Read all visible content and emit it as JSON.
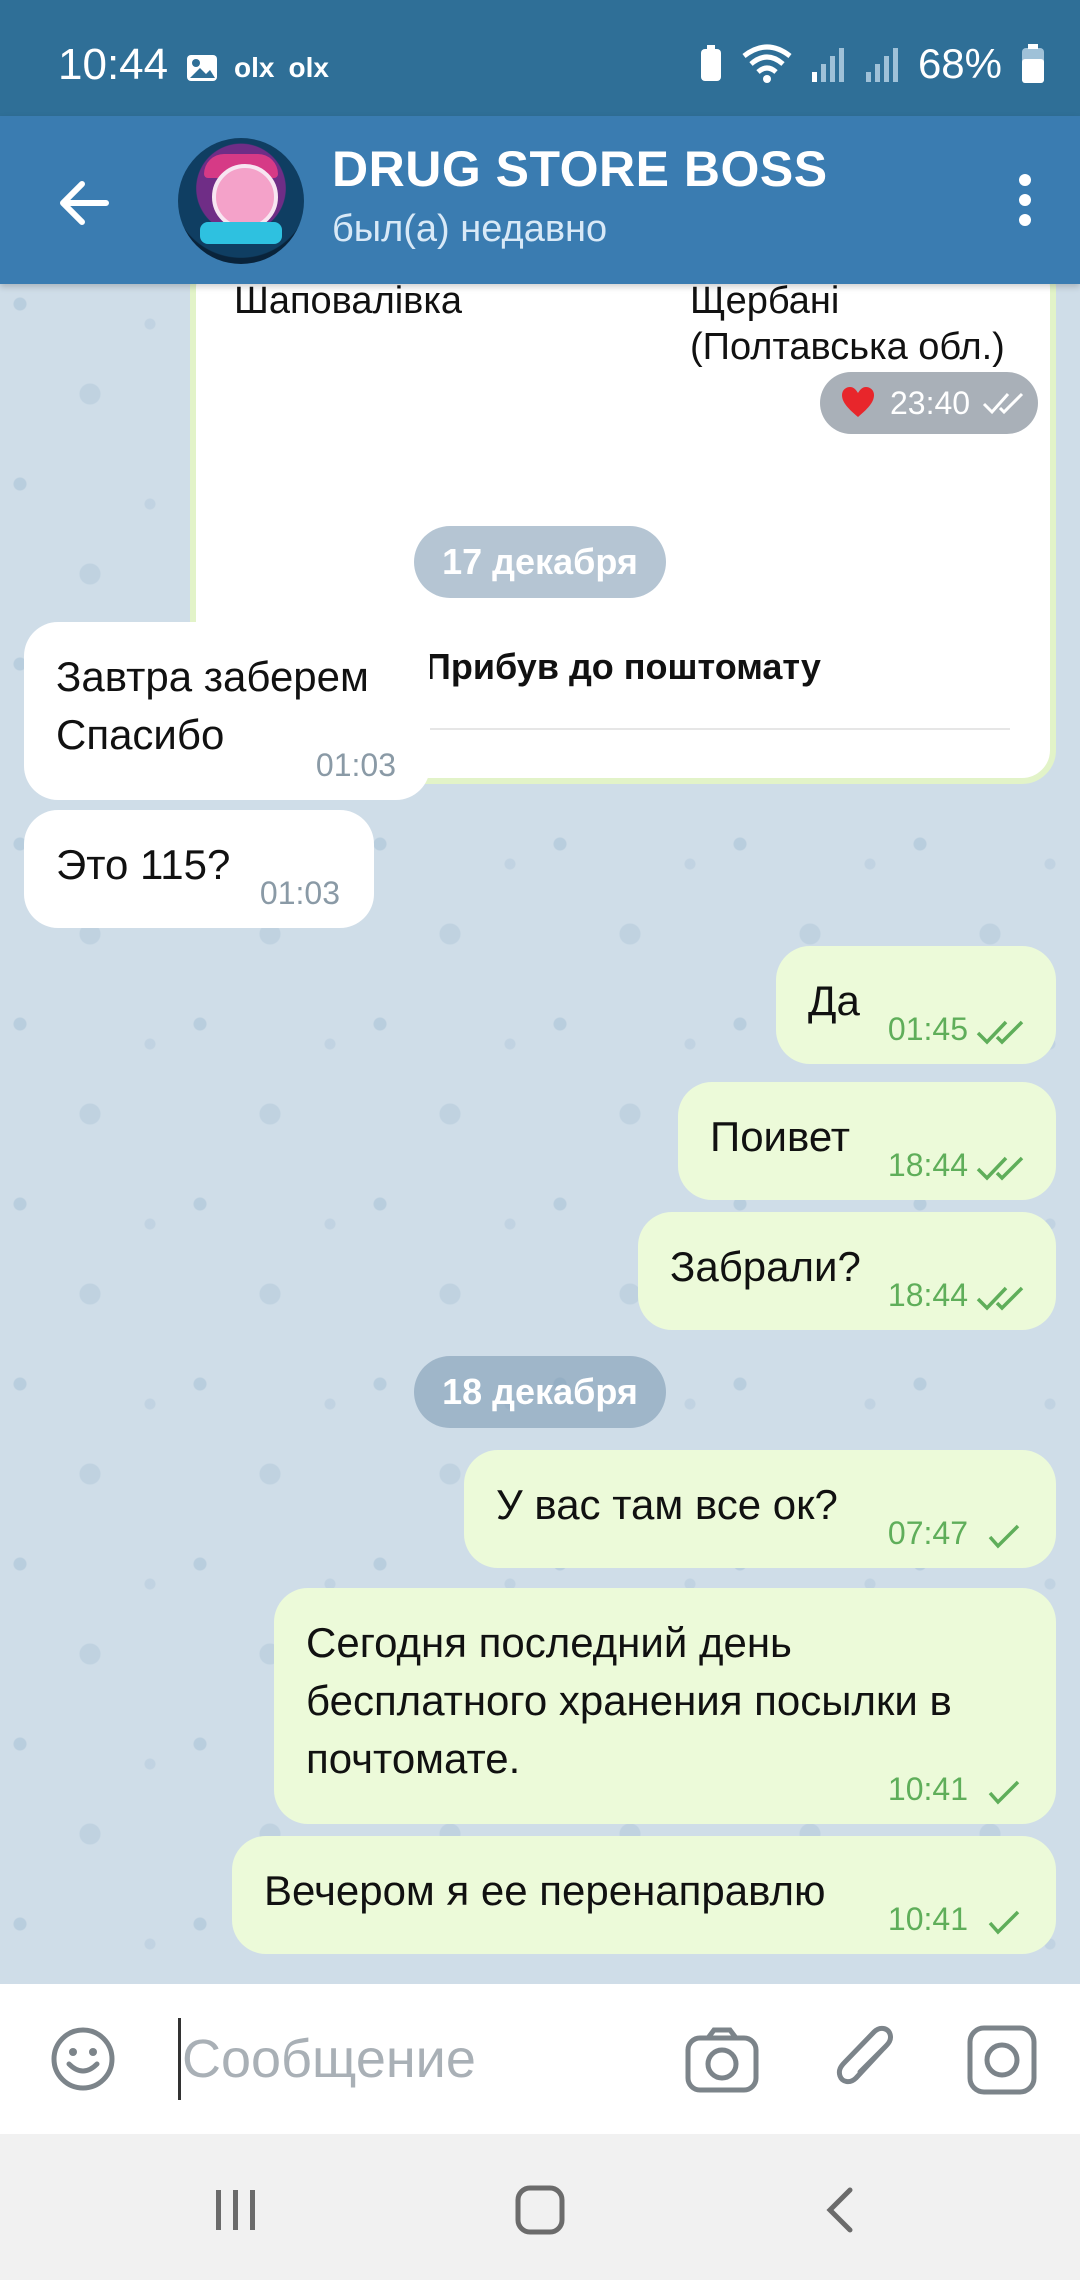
{
  "status_bar": {
    "time": "10:44",
    "left_icons": [
      "image-icon",
      "olx-icon",
      "olx-icon"
    ],
    "olx_label": "olx",
    "battery_percent": "68%"
  },
  "header": {
    "name": "DRUG STORE BOSS",
    "status": "был(а) недавно"
  },
  "parcel_card": {
    "from_city": "Шаповалівка",
    "to_city_line1": "Щербані",
    "to_city_line2": "(Полтавська обл.)",
    "status": "Прибув до поштомату",
    "reaction_time": "23:40"
  },
  "dates": [
    "17 декабря",
    "18 декабря"
  ],
  "messages": [
    {
      "dir": "in",
      "lines": [
        "Завтра заберем",
        "Спасибо"
      ],
      "time": "01:03"
    },
    {
      "dir": "in",
      "lines": [
        "Это 115?"
      ],
      "time": "01:03"
    },
    {
      "dir": "out",
      "lines": [
        "Да"
      ],
      "time": "01:45",
      "ticks": "double"
    },
    {
      "dir": "out",
      "lines": [
        "Поивет"
      ],
      "time": "18:44",
      "ticks": "double"
    },
    {
      "dir": "out",
      "lines": [
        "Забрали?"
      ],
      "time": "18:44",
      "ticks": "double"
    },
    {
      "dir": "out",
      "lines": [
        "У вас там все ок?"
      ],
      "time": "07:47",
      "ticks": "single"
    },
    {
      "dir": "out",
      "lines": [
        "Сегодня последний день",
        "бесплатного хранения посылки в",
        "почтомате."
      ],
      "time": "10:41",
      "ticks": "single"
    },
    {
      "dir": "out",
      "lines": [
        "Вечером я ее перенаправлю"
      ],
      "time": "10:41",
      "ticks": "single"
    }
  ],
  "input": {
    "placeholder": "Сообщение"
  },
  "colors": {
    "header": "#3a7cb1",
    "status_bar": "#2f6f97",
    "outgoing_bubble": "#ecfad9",
    "incoming_bubble": "#ffffff",
    "chat_background": "#cfdde8",
    "tick_green": "#5fae5a"
  }
}
